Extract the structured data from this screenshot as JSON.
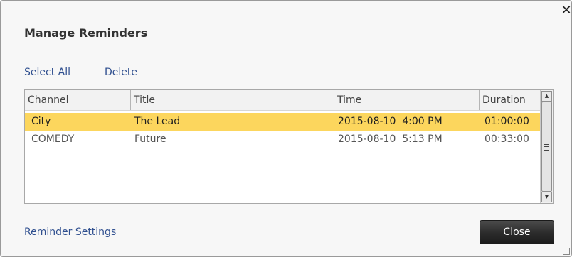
{
  "dialog": {
    "title": "Manage Reminders",
    "close_glyph": "✕"
  },
  "actions": {
    "select_all": "Select All",
    "delete": "Delete"
  },
  "table": {
    "columns": [
      "Channel",
      "Title",
      "Time",
      "Duration"
    ],
    "rows": [
      {
        "channel": "City",
        "title": "The Lead",
        "time": "2015-08-10  4:00 PM",
        "duration": "01:00:00",
        "selected": true
      },
      {
        "channel": "COMEDY",
        "title": "Future",
        "time": "2015-08-10  5:13 PM",
        "duration": "00:33:00",
        "selected": false
      }
    ]
  },
  "footer": {
    "reminder_settings": "Reminder Settings",
    "close_label": "Close"
  },
  "colors": {
    "selected_row": "#fcd65d",
    "link": "#2f4f8f",
    "button_bg": "#2b2b2b"
  }
}
